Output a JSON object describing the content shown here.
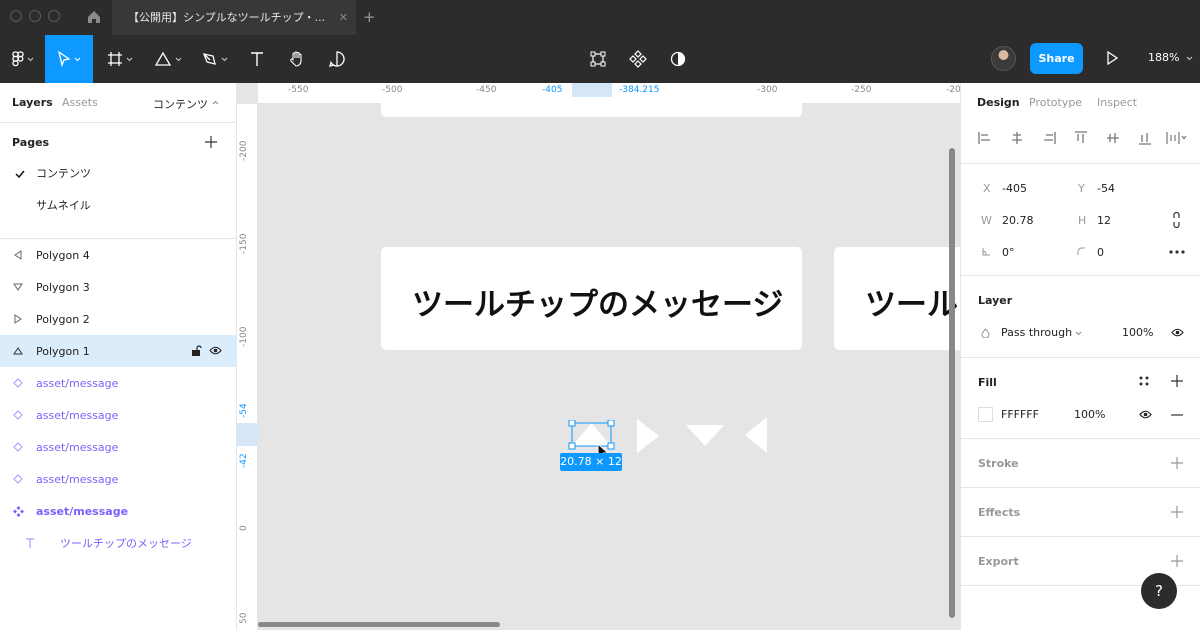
{
  "window": {
    "tab_title": "【公開用】シンプルなツールチップ・...",
    "tab_close": "✕",
    "tab_add": "+"
  },
  "toolbar": {
    "share_label": "Share",
    "zoom": "188%"
  },
  "left_panel": {
    "tabs": {
      "layers": "Layers",
      "assets": "Assets",
      "page_selector": "コンテンツ"
    },
    "pages_title": "Pages",
    "pages": [
      {
        "label": "コンテンツ",
        "current": true
      },
      {
        "label": "サムネイル",
        "current": false
      }
    ],
    "layers": [
      {
        "label": "Polygon 4",
        "icon": "triangle-left-icon"
      },
      {
        "label": "Polygon 3",
        "icon": "triangle-down-icon"
      },
      {
        "label": "Polygon 2",
        "icon": "triangle-right-icon"
      },
      {
        "label": "Polygon 1",
        "icon": "triangle-up-icon",
        "selected": true
      },
      {
        "label": "asset/message",
        "icon": "instance-icon"
      },
      {
        "label": "asset/message",
        "icon": "instance-icon"
      },
      {
        "label": "asset/message",
        "icon": "instance-icon"
      },
      {
        "label": "asset/message",
        "icon": "instance-icon"
      },
      {
        "label": "asset/message",
        "icon": "component-icon"
      },
      {
        "label": "ツールチップのメッセージ",
        "icon": "text-icon"
      }
    ]
  },
  "canvas": {
    "ruler_h": [
      "-550",
      "-500",
      "-450",
      "-405",
      "-384.215",
      "-300",
      "-250",
      "-20"
    ],
    "ruler_v": [
      "-200",
      "-150",
      "-100",
      "-54",
      "-42",
      "0",
      "50"
    ],
    "card_text_1": "ツールチップのメッセージ",
    "card_text_2": "ツール チ",
    "size_label": "20.78 × 12"
  },
  "right_panel": {
    "tabs": {
      "design": "Design",
      "prototype": "Prototype",
      "inspect": "Inspect"
    },
    "x_label": "X",
    "x_value": "-405",
    "y_label": "Y",
    "y_value": "-54",
    "w_label": "W",
    "w_value": "20.78",
    "h_label": "H",
    "h_value": "12",
    "rotation": "0°",
    "radius": "0",
    "layer_title": "Layer",
    "blend_mode": "Pass through",
    "opacity": "100%",
    "fill_title": "Fill",
    "fill_hex": "FFFFFF",
    "fill_opacity": "100%",
    "stroke_title": "Stroke",
    "effects_title": "Effects",
    "export_title": "Export"
  },
  "help_label": "?",
  "colors": {
    "accent": "#0d99ff",
    "component": "#7b61ff",
    "toolbar": "#2c2c2c"
  }
}
